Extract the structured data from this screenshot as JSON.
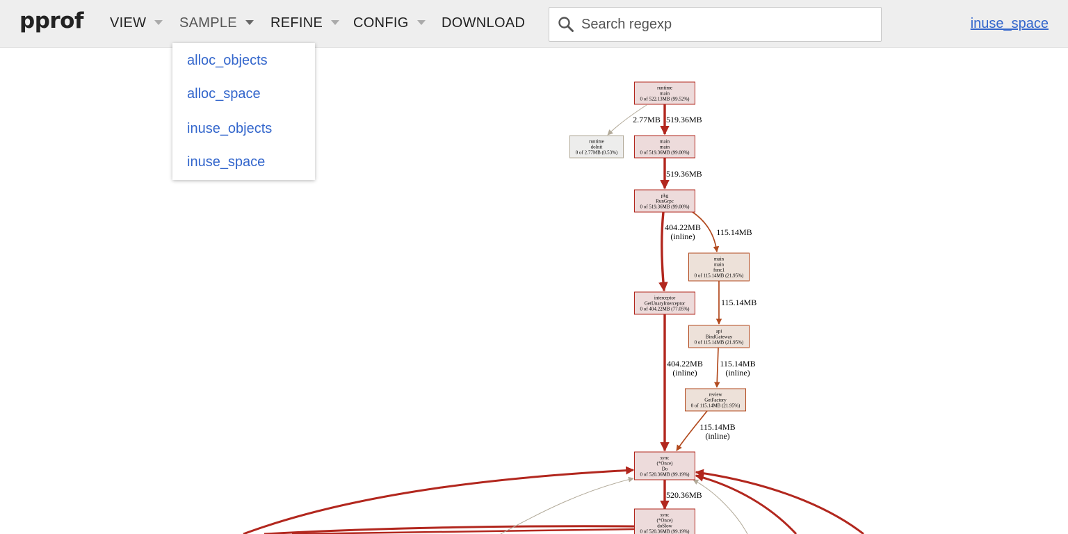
{
  "header": {
    "logo": "pprof",
    "menu": {
      "view": "VIEW",
      "sample": "SAMPLE",
      "refine": "REFINE",
      "config": "CONFIG",
      "download": "DOWNLOAD"
    },
    "search": {
      "placeholder": "Search regexp",
      "value": ""
    },
    "sample_type": "inuse_space"
  },
  "dropdown": {
    "items": [
      "alloc_objects",
      "alloc_space",
      "inuse_objects",
      "inuse_space"
    ]
  },
  "colors": {
    "header_bg": "#eeeeee",
    "link": "#3366cc",
    "edge_hot": "#b2271e",
    "edge_warm": "#b24a1e",
    "edge_cold": "#b2aa99",
    "node_hot_fill": "#eddbdb",
    "node_warm_fill": "#ede1d9",
    "node_cold_fill": "#ededec"
  },
  "chart_data": {
    "type": "call-graph",
    "nodes": [
      {
        "id": "rt_main",
        "lines": [
          "runtime",
          "main",
          "0 of 522.13MB (99.52%)"
        ],
        "flat": 0,
        "cum_mb": 522.13,
        "cum_pct": 99.52
      },
      {
        "id": "rt_doinit",
        "lines": [
          "runtime",
          "doInit",
          "0 of 2.77MB (0.53%)"
        ],
        "flat": 0,
        "cum_mb": 2.77,
        "cum_pct": 0.53
      },
      {
        "id": "main_main",
        "lines": [
          "main",
          "main",
          "0 of 519.36MB (99.00%)"
        ],
        "flat": 0,
        "cum_mb": 519.36,
        "cum_pct": 99.0
      },
      {
        "id": "pkg_rungrpc",
        "lines": [
          "pkg",
          "RunGrpc",
          "0 of 519.36MB (99.00%)"
        ],
        "flat": 0,
        "cum_mb": 519.36,
        "cum_pct": 99.0
      },
      {
        "id": "main_func1",
        "lines": [
          "main",
          "main",
          "func1",
          "0 of 115.14MB (21.95%)"
        ],
        "flat": 0,
        "cum_mb": 115.14,
        "cum_pct": 21.95
      },
      {
        "id": "interceptor",
        "lines": [
          "interceptor",
          "GetUnaryInterceptor",
          "0 of 404.22MB (77.05%)"
        ],
        "flat": 0,
        "cum_mb": 404.22,
        "cum_pct": 77.05
      },
      {
        "id": "api_bind",
        "lines": [
          "api",
          "BindGateway",
          "0 of 115.14MB (21.95%)"
        ],
        "flat": 0,
        "cum_mb": 115.14,
        "cum_pct": 21.95
      },
      {
        "id": "review_factory",
        "lines": [
          "review",
          "GetFactory",
          "0 of 115.14MB (21.95%)"
        ],
        "flat": 0,
        "cum_mb": 115.14,
        "cum_pct": 21.95
      },
      {
        "id": "sync_do",
        "lines": [
          "sync",
          "(*Once)",
          "Do",
          "0 of 520.36MB (99.19%)"
        ],
        "flat": 0,
        "cum_mb": 520.36,
        "cum_pct": 99.19
      },
      {
        "id": "sync_doslow",
        "lines": [
          "sync",
          "(*Once)",
          "doSlow",
          "0 of 520.36MB (99.19%)"
        ],
        "flat": 0,
        "cum_mb": 520.36,
        "cum_pct": 99.19
      }
    ],
    "edges": [
      {
        "from": "rt_main",
        "to": "rt_doinit",
        "label": [
          "2.77MB"
        ],
        "weight_mb": 2.77
      },
      {
        "from": "rt_main",
        "to": "main_main",
        "label": [
          "519.36MB"
        ],
        "weight_mb": 519.36
      },
      {
        "from": "main_main",
        "to": "pkg_rungrpc",
        "label": [
          "519.36MB"
        ],
        "weight_mb": 519.36
      },
      {
        "from": "pkg_rungrpc",
        "to": "interceptor",
        "label": [
          "404.22MB",
          "(inline)"
        ],
        "weight_mb": 404.22
      },
      {
        "from": "pkg_rungrpc",
        "to": "main_func1",
        "label": [
          "115.14MB"
        ],
        "weight_mb": 115.14
      },
      {
        "from": "main_func1",
        "to": "api_bind",
        "label": [
          "115.14MB"
        ],
        "weight_mb": 115.14
      },
      {
        "from": "interceptor",
        "to": "sync_do",
        "label": [
          "404.22MB",
          "(inline)"
        ],
        "weight_mb": 404.22
      },
      {
        "from": "api_bind",
        "to": "review_factory",
        "label": [
          "115.14MB",
          "(inline)"
        ],
        "weight_mb": 115.14
      },
      {
        "from": "review_factory",
        "to": "sync_do",
        "label": [
          "115.14MB",
          "(inline)"
        ],
        "weight_mb": 115.14
      },
      {
        "from": "sync_do",
        "to": "sync_doslow",
        "label": [
          "520.36MB"
        ],
        "weight_mb": 520.36
      }
    ]
  }
}
